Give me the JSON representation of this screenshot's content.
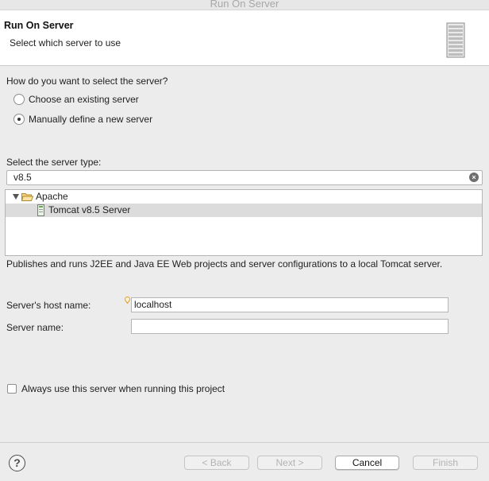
{
  "window": {
    "title": "Run On Server"
  },
  "header": {
    "title": "Run On Server",
    "subtitle": "Select which server to use"
  },
  "selection": {
    "question": "How do you want to select the server?",
    "options": [
      {
        "label": "Choose an existing server",
        "checked": false
      },
      {
        "label": "Manually define a new server",
        "checked": true
      }
    ]
  },
  "server_type": {
    "label": "Select the server type:",
    "filter_value": "v8.5",
    "tree": [
      {
        "label": "Apache",
        "expanded": true,
        "selected": false
      },
      {
        "label": "Tomcat v8.5 Server",
        "selected": true
      }
    ],
    "description": "Publishes and runs J2EE and Java EE Web projects and server configurations to a local Tomcat server."
  },
  "fields": {
    "host_label": "Server's host name:",
    "host_value": "localhost",
    "name_label": "Server name:",
    "name_value": ""
  },
  "always_use": {
    "label": "Always use this server when running this project",
    "checked": false
  },
  "buttons": {
    "help": "?",
    "back": "< Back",
    "next": "Next >",
    "cancel": "Cancel",
    "finish": "Finish"
  }
}
